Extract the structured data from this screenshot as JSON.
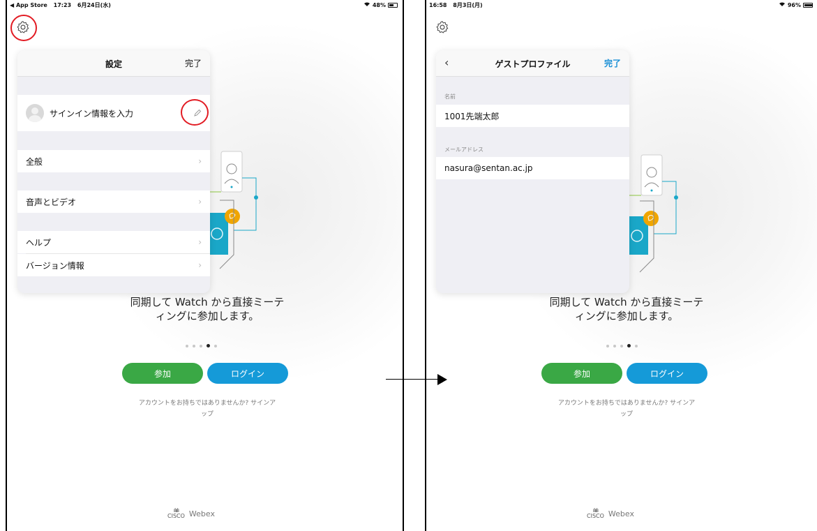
{
  "left_screen": {
    "status": {
      "carrier": "◀ App Store",
      "time": "17:23",
      "date": "6月24日(水)",
      "battery": "48%"
    },
    "settings": {
      "title": "設定",
      "done": "完了",
      "profile_label": "サインイン情報を入力",
      "items": [
        {
          "label": "全般"
        },
        {
          "label": "音声とビデオ"
        },
        {
          "label": "ヘルプ"
        },
        {
          "label": "バージョン情報"
        }
      ]
    },
    "tagline": "同期して Watch から直接ミーテ\nィングに参加します。",
    "join_button": "参加",
    "login_button": "ログイン",
    "signup_text": "アカウントをお持ちではありませんか? サインア\nップ",
    "brand": {
      "cisco": "CISCO",
      "webex": "Webex"
    }
  },
  "right_screen": {
    "status": {
      "time": "16:58",
      "date": "8月3日(月)",
      "battery": "96%"
    },
    "guest_profile": {
      "title": "ゲストプロファイル",
      "done": "完了",
      "name_label": "名前",
      "name_value": "1001先端太郎",
      "email_label": "メールアドレス",
      "email_value": "nasura@sentan.ac.jp"
    },
    "tagline": "同期して Watch から直接ミーテ\nィングに参加します。",
    "join_button": "参加",
    "login_button": "ログイン",
    "signup_text": "アカウントをお持ちではありませんか? サインア\nップ",
    "brand": {
      "cisco": "CISCO",
      "webex": "Webex"
    }
  },
  "pager": {
    "total": 5,
    "active_index": 3
  },
  "colors": {
    "join_green": "#3aa845",
    "login_blue": "#159ad8",
    "highlight_red": "#e21b23",
    "accent_teal": "#1aa7c8",
    "accent_orange": "#f0a500"
  }
}
